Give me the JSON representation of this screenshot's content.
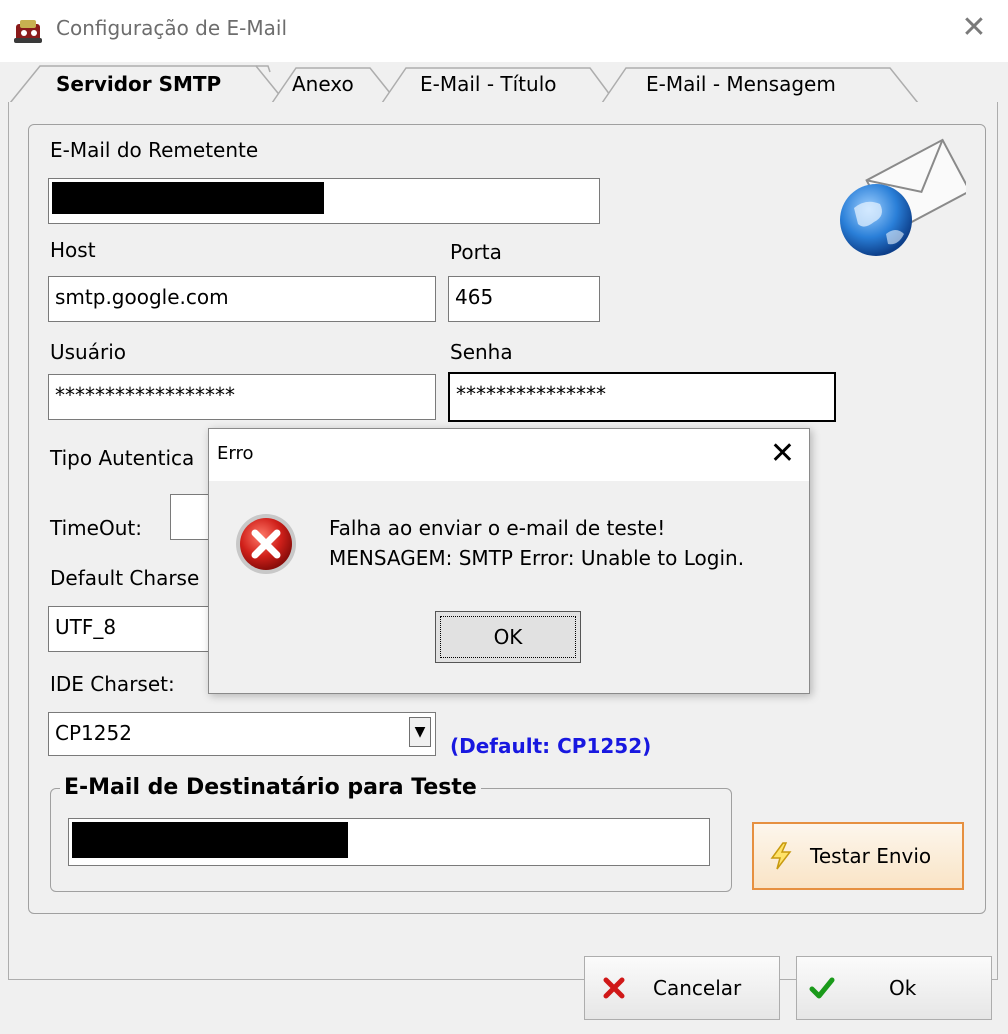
{
  "window": {
    "title": "Configuração de E-Mail"
  },
  "tabs": [
    {
      "label": "Servidor SMTP",
      "active": true
    },
    {
      "label": "Anexo",
      "active": false
    },
    {
      "label": "E-Mail - Título",
      "active": false
    },
    {
      "label": "E-Mail - Mensagem",
      "active": false
    }
  ],
  "form": {
    "sender_label": "E-Mail do Remetente",
    "sender_value": "",
    "host_label": "Host",
    "host_value": "smtp.google.com",
    "port_label": "Porta",
    "port_value": "465",
    "user_label": "Usuário",
    "user_value": "******************",
    "password_label": "Senha",
    "password_value": "***************",
    "auth_label": "Tipo Autentica",
    "timeout_label": "TimeOut:",
    "charset_label": "Default Charse",
    "charset_value": "UTF_8",
    "ide_charset_label": "IDE Charset:",
    "ide_charset_value": "CP1252",
    "ide_charset_note": "(Default: CP1252)"
  },
  "test_group": {
    "title": "E-Mail de Destinatário para Teste",
    "recipient_value": "",
    "test_button_label": "Testar Envio"
  },
  "footer": {
    "cancel_label": "Cancelar",
    "ok_label": "Ok"
  },
  "dialog": {
    "title": "Erro",
    "message_line1": "Falha ao enviar o e-mail de teste!",
    "message_line2": "MENSAGEM: SMTP Error: Unable to Login.",
    "ok_label": "OK"
  },
  "colors": {
    "accent_note": "#1818e0",
    "error_red": "#c81818",
    "test_button_border": "#e69040"
  }
}
